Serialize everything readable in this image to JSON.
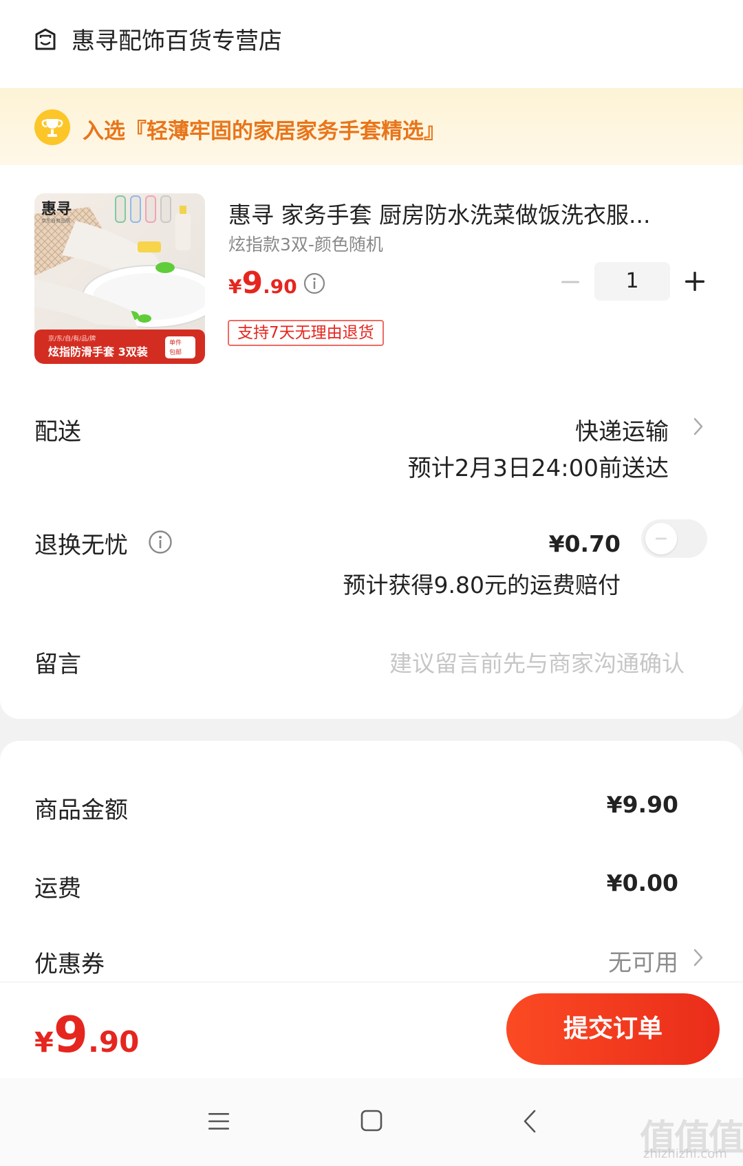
{
  "store": {
    "name": "惠寻配饰百货专营店",
    "icon": "store-icon"
  },
  "banner": {
    "text": "入选『轻薄牢固的家居家务手套精选』",
    "icon": "trophy-icon"
  },
  "product": {
    "title": "惠寻 家务手套 厨房防水洗菜做饭洗衣服...",
    "spec": "炫指款3双-颜色随机",
    "price_symbol": "¥",
    "price_int": "9",
    "price_dec": ".90",
    "return_badge": "支持7天无理由退货",
    "quantity": "1",
    "image": {
      "brand": "惠寻",
      "brand_sub": "京东自有品牌",
      "bar_small": "京/东/自/有/品/牌",
      "bar_text": "炫指防滑手套 3双装",
      "bar_tag": "单件包邮"
    }
  },
  "shipping": {
    "label": "配送",
    "method": "快递运输",
    "eta": "预计2月3日24:00前送达"
  },
  "return_insurance": {
    "label": "退换无忧",
    "price": "¥0.70",
    "desc": "预计获得9.80元的运费赔付",
    "enabled": false
  },
  "message": {
    "label": "留言",
    "placeholder": "建议留言前先与商家沟通确认"
  },
  "summary": {
    "goods_label": "商品金额",
    "goods_value": "¥9.90",
    "shipping_label": "运费",
    "shipping_value": "¥0.00",
    "coupon_label": "优惠券",
    "coupon_value": "无可用"
  },
  "footer": {
    "total_symbol": "¥",
    "total_int": "9",
    "total_dec": ".90",
    "submit_label": "提交订单"
  },
  "watermark": {
    "text": "值值值",
    "url": "zhizhizhi.com"
  },
  "colors": {
    "accent": "#e5261f",
    "banner_text": "#e8751b",
    "button": "#f23d1f"
  }
}
